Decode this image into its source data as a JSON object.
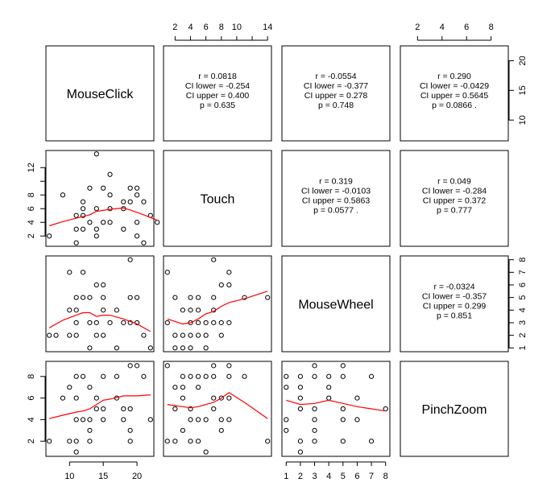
{
  "chart_data": {
    "type": "scatter",
    "title": "",
    "variables": [
      "MouseClick",
      "Touch",
      "MouseWheel",
      "PinchZoom"
    ],
    "axes": {
      "MouseClick": {
        "ticks": [
          10,
          15,
          20
        ],
        "range": [
          6.5,
          22.5
        ]
      },
      "Touch": {
        "ticks": [
          2,
          4,
          6,
          8,
          10,
          14
        ],
        "tick_marks": [
          2,
          4,
          6,
          8,
          10,
          12,
          14
        ],
        "y_ticks": [
          2,
          4,
          6,
          8,
          12
        ],
        "range": [
          0.5,
          14.5
        ]
      },
      "MouseWheel": {
        "ticks": [
          1,
          2,
          3,
          4,
          5,
          6,
          7,
          8
        ],
        "range": [
          0.7,
          8.3
        ]
      },
      "PinchZoom": {
        "ticks": [
          2,
          4,
          6,
          8
        ],
        "range": [
          0.6,
          9.4
        ]
      }
    },
    "diagonal_labels": [
      "MouseClick",
      "Touch",
      "MouseWheel",
      "PinchZoom"
    ],
    "upper_panels": [
      {
        "row": 0,
        "col": 1,
        "lines": [
          "r = 0.0818",
          "CI lower = -0.254",
          "CI upper =  0.400",
          "p = 0.635"
        ]
      },
      {
        "row": 0,
        "col": 2,
        "lines": [
          "r = -0.0554",
          "CI lower = -0.377",
          "CI upper =  0.278",
          "p = 0.748"
        ]
      },
      {
        "row": 0,
        "col": 3,
        "lines": [
          "r = 0.290",
          "CI lower = -0.0429",
          "CI upper =  0.5645",
          "p = 0.0866 ."
        ]
      },
      {
        "row": 1,
        "col": 2,
        "lines": [
          "r = 0.319",
          "CI lower = -0.0103",
          "CI upper =  0.5863",
          "p = 0.0577 ."
        ]
      },
      {
        "row": 1,
        "col": 3,
        "lines": [
          "r = 0.049",
          "CI lower = -0.284",
          "CI upper =  0.372",
          "p = 0.777"
        ]
      },
      {
        "row": 2,
        "col": 3,
        "lines": [
          "r = -0.0324",
          "CI lower = -0.357",
          "CI upper =  0.299",
          "p = 0.851"
        ]
      }
    ],
    "lower_panels": [
      {
        "row": 1,
        "col": 0,
        "x_var": "MouseClick",
        "y_var": "Touch",
        "points": [
          [
            7,
            2
          ],
          [
            9,
            8
          ],
          [
            11,
            1
          ],
          [
            11,
            3
          ],
          [
            11,
            5
          ],
          [
            12,
            3
          ],
          [
            12,
            5
          ],
          [
            12,
            6
          ],
          [
            12,
            7
          ],
          [
            13,
            4
          ],
          [
            14,
            2
          ],
          [
            14,
            3
          ],
          [
            14,
            6
          ],
          [
            14,
            14
          ],
          [
            13,
            9
          ],
          [
            15,
            4
          ],
          [
            15,
            9
          ],
          [
            16,
            4
          ],
          [
            16,
            6
          ],
          [
            16,
            8
          ],
          [
            16,
            11
          ],
          [
            18,
            3
          ],
          [
            18,
            6
          ],
          [
            18,
            7
          ],
          [
            19,
            7
          ],
          [
            19,
            9
          ],
          [
            20,
            9
          ],
          [
            20,
            2
          ],
          [
            20,
            4
          ],
          [
            20,
            8
          ],
          [
            21,
            1
          ],
          [
            21,
            7
          ],
          [
            22,
            5
          ],
          [
            23,
            4
          ]
        ],
        "smooth": [
          [
            7,
            3.5
          ],
          [
            9,
            4.1
          ],
          [
            11,
            4.6
          ],
          [
            13,
            5.1
          ],
          [
            14,
            5.6
          ],
          [
            16,
            5.9
          ],
          [
            18,
            6.1
          ],
          [
            19,
            5.8
          ],
          [
            21,
            5.1
          ],
          [
            23,
            4.3
          ]
        ]
      },
      {
        "row": 2,
        "col": 0,
        "x_var": "MouseClick",
        "y_var": "MouseWheel",
        "points": [
          [
            7,
            2
          ],
          [
            8,
            2
          ],
          [
            10,
            2
          ],
          [
            11,
            2
          ],
          [
            10,
            4
          ],
          [
            11,
            4
          ],
          [
            10,
            7
          ],
          [
            12,
            7
          ],
          [
            11,
            5
          ],
          [
            12,
            5
          ],
          [
            13,
            5
          ],
          [
            14,
            6
          ],
          [
            15,
            6
          ],
          [
            15,
            5
          ],
          [
            15,
            4
          ],
          [
            17,
            4
          ],
          [
            14,
            2
          ],
          [
            15,
            2
          ],
          [
            11,
            3
          ],
          [
            13,
            3
          ],
          [
            14,
            3
          ],
          [
            16,
            3
          ],
          [
            18,
            3
          ],
          [
            19,
            3
          ],
          [
            20,
            3
          ],
          [
            19,
            5
          ],
          [
            20,
            5
          ],
          [
            13,
            1
          ],
          [
            17,
            1
          ],
          [
            22,
            1
          ],
          [
            19,
            8
          ],
          [
            21,
            2
          ]
        ],
        "smooth": [
          [
            7,
            2.6
          ],
          [
            9,
            3.2
          ],
          [
            11,
            3.6
          ],
          [
            12,
            3.8
          ],
          [
            13,
            3.8
          ],
          [
            14,
            3.5
          ],
          [
            15,
            3.6
          ],
          [
            16,
            3.6
          ],
          [
            18,
            3.3
          ],
          [
            20,
            2.9
          ],
          [
            22,
            2.3
          ]
        ]
      },
      {
        "row": 3,
        "col": 0,
        "x_var": "MouseClick",
        "y_var": "PinchZoom",
        "points": [
          [
            7,
            2
          ],
          [
            9,
            6
          ],
          [
            10,
            7
          ],
          [
            10,
            2
          ],
          [
            11,
            8
          ],
          [
            11,
            6
          ],
          [
            11,
            2
          ],
          [
            11,
            1
          ],
          [
            11,
            4
          ],
          [
            12,
            8
          ],
          [
            12,
            4
          ],
          [
            13,
            7
          ],
          [
            13,
            4
          ],
          [
            13,
            3
          ],
          [
            13,
            2
          ],
          [
            14,
            6
          ],
          [
            14,
            5
          ],
          [
            15,
            8
          ],
          [
            15,
            5
          ],
          [
            15,
            4
          ],
          [
            17,
            8
          ],
          [
            17,
            6
          ],
          [
            18,
            5
          ],
          [
            18,
            4
          ],
          [
            19,
            9
          ],
          [
            19,
            5
          ],
          [
            19,
            3
          ],
          [
            19,
            2
          ],
          [
            20,
            9
          ],
          [
            21,
            8
          ],
          [
            22,
            4
          ]
        ],
        "smooth": [
          [
            7,
            4.1
          ],
          [
            9,
            4.4
          ],
          [
            11,
            4.7
          ],
          [
            12,
            4.8
          ],
          [
            13,
            5.0
          ],
          [
            15,
            5.8
          ],
          [
            16,
            5.9
          ],
          [
            18,
            6.2
          ],
          [
            20,
            6.2
          ],
          [
            22,
            6.3
          ]
        ]
      },
      {
        "row": 2,
        "col": 1,
        "x_var": "Touch",
        "y_var": "MouseWheel",
        "points": [
          [
            1,
            7
          ],
          [
            1,
            3
          ],
          [
            2,
            5
          ],
          [
            2,
            2
          ],
          [
            2,
            1
          ],
          [
            3,
            4
          ],
          [
            3,
            2
          ],
          [
            3,
            1
          ],
          [
            4,
            5
          ],
          [
            4,
            4
          ],
          [
            4,
            3
          ],
          [
            4,
            2
          ],
          [
            4,
            1
          ],
          [
            5,
            5
          ],
          [
            5,
            4
          ],
          [
            5,
            3
          ],
          [
            5,
            2
          ],
          [
            6,
            3
          ],
          [
            6,
            2
          ],
          [
            6,
            1
          ],
          [
            7,
            8
          ],
          [
            7,
            5
          ],
          [
            7,
            4
          ],
          [
            7,
            3
          ],
          [
            8,
            6
          ],
          [
            8,
            3
          ],
          [
            8,
            2
          ],
          [
            9,
            7
          ],
          [
            9,
            6
          ],
          [
            9,
            3
          ],
          [
            11,
            5
          ],
          [
            14,
            5
          ]
        ],
        "smooth": [
          [
            1,
            3.3
          ],
          [
            2,
            3.1
          ],
          [
            3,
            2.9
          ],
          [
            4,
            3.0
          ],
          [
            5,
            3.3
          ],
          [
            6,
            3.7
          ],
          [
            7,
            3.9
          ],
          [
            8,
            4.3
          ],
          [
            9,
            4.6
          ],
          [
            11,
            4.9
          ],
          [
            14,
            5.5
          ]
        ]
      },
      {
        "row": 3,
        "col": 1,
        "x_var": "Touch",
        "y_var": "PinchZoom",
        "points": [
          [
            1,
            9
          ],
          [
            1,
            2
          ],
          [
            2,
            7
          ],
          [
            2,
            5
          ],
          [
            2,
            2
          ],
          [
            3,
            8
          ],
          [
            3,
            7
          ],
          [
            3,
            6
          ],
          [
            3,
            3
          ],
          [
            4,
            8
          ],
          [
            4,
            5
          ],
          [
            4,
            4
          ],
          [
            4,
            2
          ],
          [
            5,
            8
          ],
          [
            5,
            7
          ],
          [
            5,
            4
          ],
          [
            5,
            2
          ],
          [
            6,
            8
          ],
          [
            6,
            4
          ],
          [
            6,
            1
          ],
          [
            7,
            9
          ],
          [
            7,
            8
          ],
          [
            7,
            6
          ],
          [
            7,
            5
          ],
          [
            8,
            6
          ],
          [
            8,
            4
          ],
          [
            8,
            3
          ],
          [
            9,
            9
          ],
          [
            9,
            8
          ],
          [
            9,
            6
          ],
          [
            9,
            4
          ],
          [
            11,
            8
          ],
          [
            14,
            2
          ]
        ],
        "smooth": [
          [
            1,
            5.4
          ],
          [
            2,
            5.3
          ],
          [
            3,
            5.2
          ],
          [
            4,
            5.1
          ],
          [
            5,
            5.2
          ],
          [
            6,
            5.4
          ],
          [
            7,
            5.6
          ],
          [
            8,
            6.0
          ],
          [
            9,
            6.5
          ],
          [
            11,
            5.6
          ],
          [
            14,
            4.1
          ]
        ]
      },
      {
        "row": 3,
        "col": 2,
        "x_var": "MouseWheel",
        "y_var": "PinchZoom",
        "points": [
          [
            1,
            8
          ],
          [
            1,
            7
          ],
          [
            1,
            4
          ],
          [
            1,
            3
          ],
          [
            2,
            8
          ],
          [
            2,
            7
          ],
          [
            2,
            6
          ],
          [
            2,
            5
          ],
          [
            2,
            2
          ],
          [
            2,
            1
          ],
          [
            3,
            9
          ],
          [
            3,
            8
          ],
          [
            3,
            5
          ],
          [
            3,
            4
          ],
          [
            3,
            3
          ],
          [
            3,
            2
          ],
          [
            4,
            8
          ],
          [
            4,
            7
          ],
          [
            4,
            6
          ],
          [
            5,
            9
          ],
          [
            5,
            8
          ],
          [
            5,
            5
          ],
          [
            5,
            4
          ],
          [
            5,
            2
          ],
          [
            6,
            6
          ],
          [
            6,
            4
          ],
          [
            7,
            8
          ],
          [
            7,
            2
          ],
          [
            8,
            5
          ]
        ],
        "smooth": [
          [
            1,
            5.8
          ],
          [
            2,
            5.4
          ],
          [
            3,
            5.5
          ],
          [
            4,
            5.8
          ],
          [
            5,
            5.5
          ],
          [
            6,
            5.2
          ],
          [
            7,
            5.0
          ],
          [
            8,
            4.8
          ]
        ]
      }
    ],
    "smooth_color": "#ff0000",
    "point_color": "#000000",
    "grid": false,
    "legend": "none"
  }
}
